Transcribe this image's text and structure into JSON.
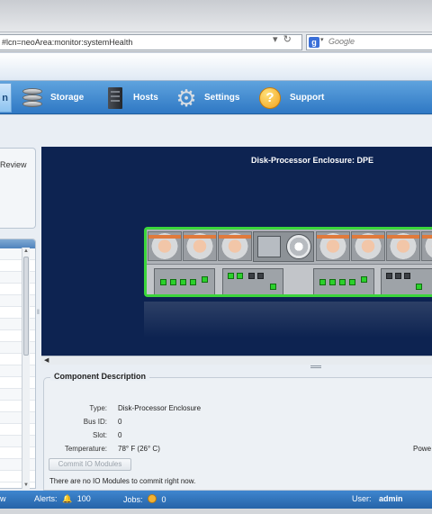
{
  "browser": {
    "url": "#lcn=neoArea:monitor:systemHealth",
    "reload_glyph": "C",
    "search_engine": "Google",
    "search_placeholder": "Google"
  },
  "nav": {
    "active_partial": "n",
    "items": [
      {
        "label": "Storage",
        "icon": "storage-disks-icon"
      },
      {
        "label": "Hosts",
        "icon": "server-tower-icon"
      },
      {
        "label": "Settings",
        "icon": "gear-icon"
      },
      {
        "label": "Support",
        "icon": "question-icon"
      }
    ]
  },
  "left": {
    "review_partial": "Review"
  },
  "enclosure": {
    "title": "Disk-Processor Enclosure: DPE",
    "status_color": "#3bd63b"
  },
  "component": {
    "legend": "Component Description",
    "properties": [
      {
        "label": "Type:",
        "value": "Disk-Processor Enclosure"
      },
      {
        "label": "Bus ID:",
        "value": "0"
      },
      {
        "label": "Slot:",
        "value": "0"
      },
      {
        "label": "Temperature:",
        "value": "78° F (26° C)"
      }
    ],
    "power_partial": "Powe",
    "commit_button": "Commit IO Modules",
    "message": "There are no IO Modules to commit right now."
  },
  "status": {
    "left_partial": "w",
    "alerts_label": "Alerts:",
    "alerts_count": "100",
    "jobs_label": "Jobs:",
    "jobs_count": "0",
    "user_label": "User:",
    "user_name": "admin"
  },
  "colors": {
    "nav": "#2f78c4",
    "enclosure_bg": "#0d2351",
    "status_bar": "#2563a8"
  }
}
